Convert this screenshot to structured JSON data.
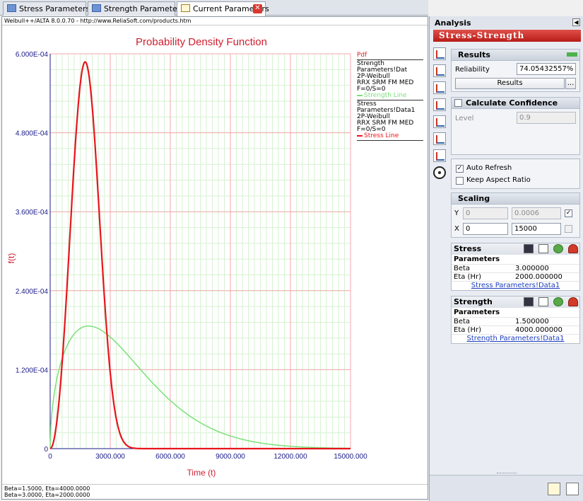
{
  "tabs": [
    {
      "label": "Stress Parameters",
      "active": false
    },
    {
      "label": "Strength Parameters",
      "active": false
    },
    {
      "label": "Current Parameters",
      "active": true
    }
  ],
  "plot": {
    "url_text": "Weibull++/ALTA 8.0.0.70 - http://www.ReliaSoft.com/products.htm",
    "footer_line1": "Beta=1.5000, Eta=4000.0000",
    "footer_line2": "Beta=3.0000, Eta=2000.0000"
  },
  "legend": {
    "title": "Pdf",
    "entries": [
      {
        "source": "Strength Parameters!Dat",
        "model": "2P-Weibull",
        "method": "RRX SRM FM MED",
        "fs": "F=0/S=0",
        "line": "Strength Line",
        "color": "#7be07b"
      },
      {
        "source": "Stress Parameters!Data1",
        "model": "2P-Weibull",
        "method": "RRX SRM FM MED",
        "fs": "F=0/S=0",
        "line": "Stress Line",
        "color": "#e8141c"
      }
    ]
  },
  "chart_data": {
    "type": "line",
    "title": "Probability Density Function",
    "xlabel": "Time (t)",
    "ylabel": "f(t)",
    "xlim": [
      0,
      15000
    ],
    "ylim": [
      0,
      0.0006
    ],
    "x_ticks": [
      "0",
      "3000.000",
      "6000.000",
      "9000.000",
      "12000.000",
      "15000.000"
    ],
    "y_ticks": [
      "0",
      "1.200E-04",
      "2.400E-04",
      "3.600E-04",
      "4.800E-04",
      "6.000E-04"
    ],
    "grid": true,
    "legend_position": "right",
    "series": [
      {
        "name": "Strength Line",
        "distribution": "2P-Weibull",
        "beta": 1.5,
        "eta": 4000,
        "color": "#7be07b"
      },
      {
        "name": "Stress Line",
        "distribution": "2P-Weibull",
        "beta": 3.0,
        "eta": 2000,
        "color": "#e8141c"
      }
    ]
  },
  "analysis": {
    "title": "Analysis",
    "banner": "Stress-Strength",
    "results": {
      "title": "Results",
      "reliability_label": "Reliability",
      "reliability_value": "74.05432557%",
      "results_button": "Results",
      "more_button": "..."
    },
    "confidence": {
      "title": "Calculate Confidence",
      "level_label": "Level",
      "level_value": "0.9"
    },
    "options": {
      "auto_refresh": "Auto Refresh",
      "keep_aspect": "Keep Aspect Ratio"
    },
    "scaling": {
      "title": "Scaling",
      "y_label": "Y",
      "y_min": "0",
      "y_max": "0.0006",
      "x_label": "X",
      "x_min": "0",
      "x_max": "15000"
    },
    "stress": {
      "title": "Stress",
      "sub": "Parameters",
      "rows": [
        {
          "name": "Beta",
          "value": "3.000000"
        },
        {
          "name": "Eta (Hr)",
          "value": "2000.000000"
        }
      ],
      "link": "Stress Parameters!Data1"
    },
    "strength": {
      "title": "Strength",
      "sub": "Parameters",
      "rows": [
        {
          "name": "Beta",
          "value": "1.500000"
        },
        {
          "name": "Eta (Hr)",
          "value": "4000.000000"
        }
      ],
      "link": "Strength Parameters!Data1"
    }
  }
}
